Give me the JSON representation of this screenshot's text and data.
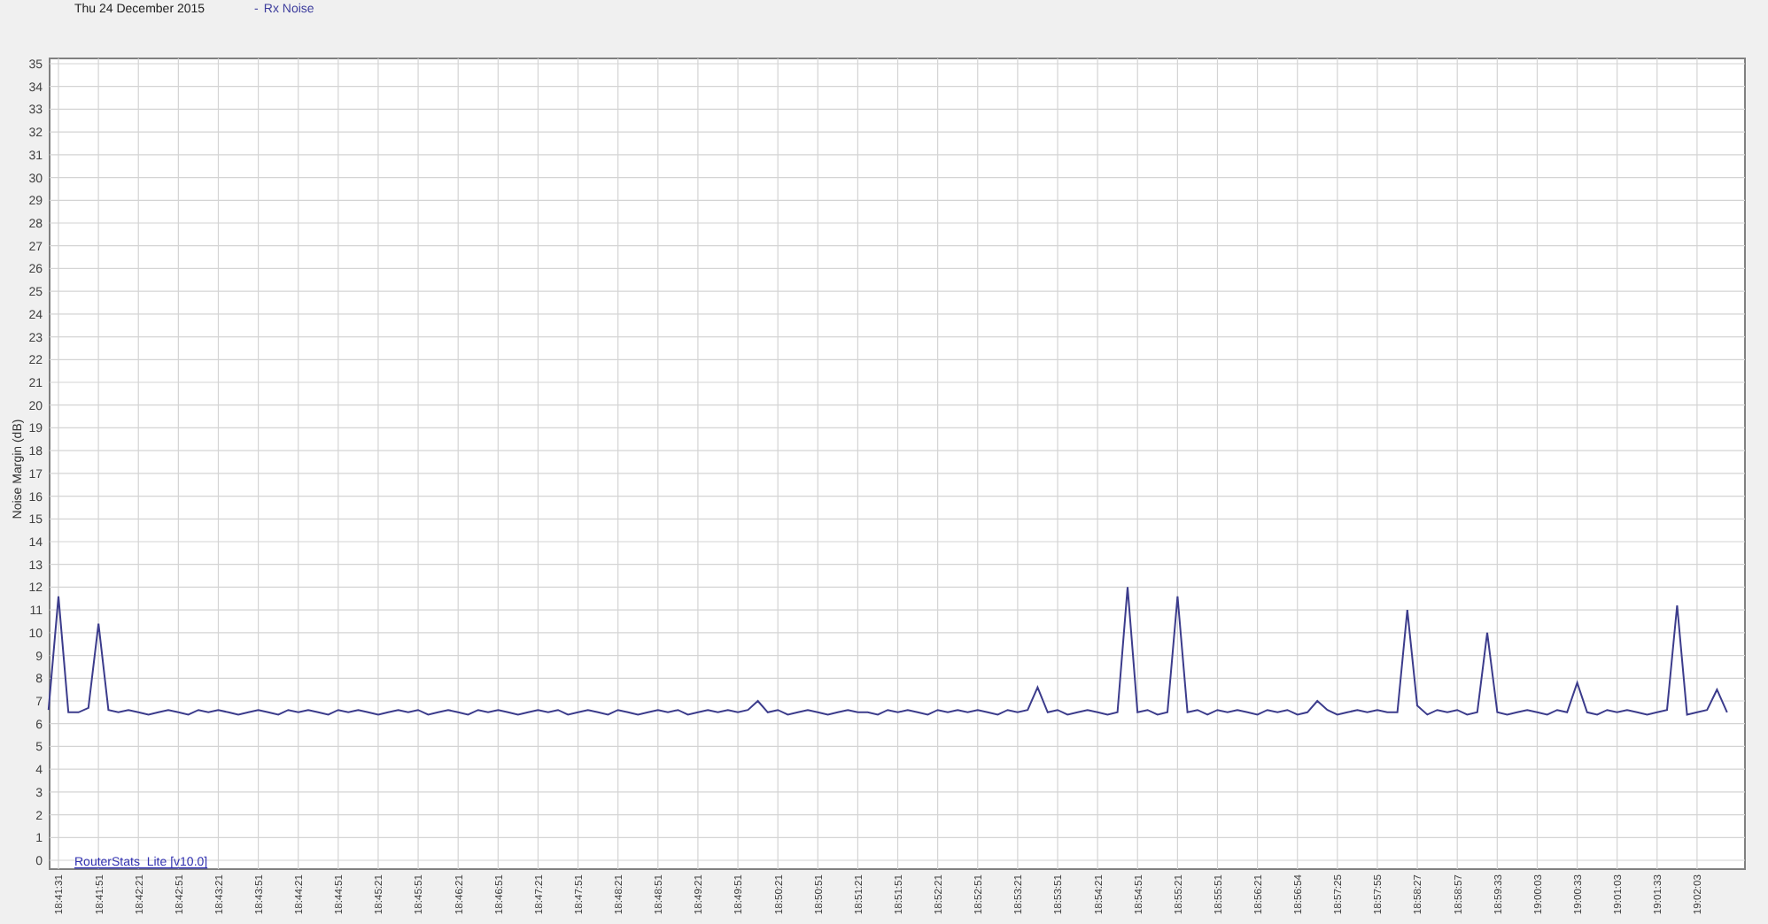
{
  "header": {
    "date": "Thu 24 December 2015",
    "legend_marker": "-"
  },
  "chart": {
    "footer_label": "RouterStats  Lite [v10.0]",
    "chart_data": {
      "type": "line",
      "ylabel": "Noise Margin (dB)",
      "grid": true,
      "categories": [
        null,
        "18:41:31",
        null,
        null,
        null,
        "18:41:51",
        null,
        null,
        null,
        "18:42:21",
        null,
        null,
        null,
        "18:42:51",
        null,
        null,
        null,
        "18:43:21",
        null,
        null,
        null,
        "18:43:51",
        null,
        null,
        null,
        "18:44:21",
        null,
        null,
        null,
        "18:44:51",
        null,
        null,
        null,
        "18:45:21",
        null,
        null,
        null,
        "18:45:51",
        null,
        null,
        null,
        "18:46:21",
        null,
        null,
        null,
        "18:46:51",
        null,
        null,
        null,
        "18:47:21",
        null,
        null,
        null,
        "18:47:51",
        null,
        null,
        null,
        "18:48:21",
        null,
        null,
        null,
        "18:48:51",
        null,
        null,
        null,
        "18:49:21",
        null,
        null,
        null,
        "18:49:51",
        null,
        null,
        null,
        "18:50:21",
        null,
        null,
        null,
        "18:50:51",
        null,
        null,
        null,
        "18:51:21",
        null,
        null,
        null,
        "18:51:51",
        null,
        null,
        null,
        "18:52:21",
        null,
        null,
        null,
        "18:52:51",
        null,
        null,
        null,
        "18:53:21",
        null,
        null,
        null,
        "18:53:51",
        null,
        null,
        null,
        "18:54:21",
        null,
        null,
        null,
        "18:54:51",
        null,
        null,
        null,
        "18:55:21",
        null,
        null,
        null,
        "18:55:51",
        null,
        null,
        null,
        "18:56:21",
        null,
        null,
        null,
        "18:56:54",
        null,
        null,
        null,
        "18:57:25",
        null,
        null,
        null,
        "18:57:55",
        null,
        null,
        null,
        "18:58:27",
        null,
        null,
        null,
        "18:58:57",
        null,
        null,
        null,
        "18:59:33",
        null,
        null,
        null,
        "19:00:03",
        null,
        null,
        null,
        "19:00:33",
        null,
        null,
        null,
        "19:01:03",
        null,
        null,
        null,
        "19:01:33",
        null,
        null,
        null,
        "19:02:03",
        null,
        null,
        null
      ],
      "series": [
        {
          "name": "Rx Noise",
          "color": "#3c3c8c",
          "values": [
            6.6,
            11.6,
            6.5,
            6.5,
            6.7,
            10.4,
            6.6,
            6.5,
            6.6,
            6.5,
            6.4,
            6.5,
            6.6,
            6.5,
            6.4,
            6.6,
            6.5,
            6.6,
            6.5,
            6.4,
            6.5,
            6.6,
            6.5,
            6.4,
            6.6,
            6.5,
            6.6,
            6.5,
            6.4,
            6.6,
            6.5,
            6.6,
            6.5,
            6.4,
            6.5,
            6.6,
            6.5,
            6.6,
            6.4,
            6.5,
            6.6,
            6.5,
            6.4,
            6.6,
            6.5,
            6.6,
            6.5,
            6.4,
            6.5,
            6.6,
            6.5,
            6.6,
            6.4,
            6.5,
            6.6,
            6.5,
            6.4,
            6.6,
            6.5,
            6.4,
            6.5,
            6.6,
            6.5,
            6.6,
            6.4,
            6.5,
            6.6,
            6.5,
            6.6,
            6.5,
            6.6,
            7.0,
            6.5,
            6.6,
            6.4,
            6.5,
            6.6,
            6.5,
            6.4,
            6.5,
            6.6,
            6.5,
            6.5,
            6.4,
            6.6,
            6.5,
            6.6,
            6.5,
            6.4,
            6.6,
            6.5,
            6.6,
            6.5,
            6.6,
            6.5,
            6.4,
            6.6,
            6.5,
            6.6,
            7.6,
            6.5,
            6.6,
            6.4,
            6.5,
            6.6,
            6.5,
            6.4,
            6.5,
            12.0,
            6.5,
            6.6,
            6.4,
            6.5,
            11.6,
            6.5,
            6.6,
            6.4,
            6.6,
            6.5,
            6.6,
            6.5,
            6.4,
            6.6,
            6.5,
            6.6,
            6.4,
            6.5,
            7.0,
            6.6,
            6.4,
            6.5,
            6.6,
            6.5,
            6.6,
            6.5,
            6.5,
            11.0,
            6.8,
            6.4,
            6.6,
            6.5,
            6.6,
            6.4,
            6.5,
            10.0,
            6.5,
            6.4,
            6.5,
            6.6,
            6.5,
            6.4,
            6.6,
            6.5,
            7.8,
            6.5,
            6.4,
            6.6,
            6.5,
            6.6,
            6.5,
            6.4,
            6.5,
            6.6,
            11.2,
            6.4,
            6.5,
            6.6,
            7.5,
            6.5
          ]
        }
      ],
      "ylim": [
        0,
        35
      ],
      "yticks": [
        0,
        1,
        2,
        3,
        4,
        5,
        6,
        7,
        8,
        9,
        10,
        11,
        12,
        13,
        14,
        15,
        16,
        17,
        18,
        19,
        20,
        21,
        22,
        23,
        24,
        25,
        26,
        27,
        28,
        29,
        30,
        31,
        32,
        33,
        34,
        35
      ]
    }
  }
}
